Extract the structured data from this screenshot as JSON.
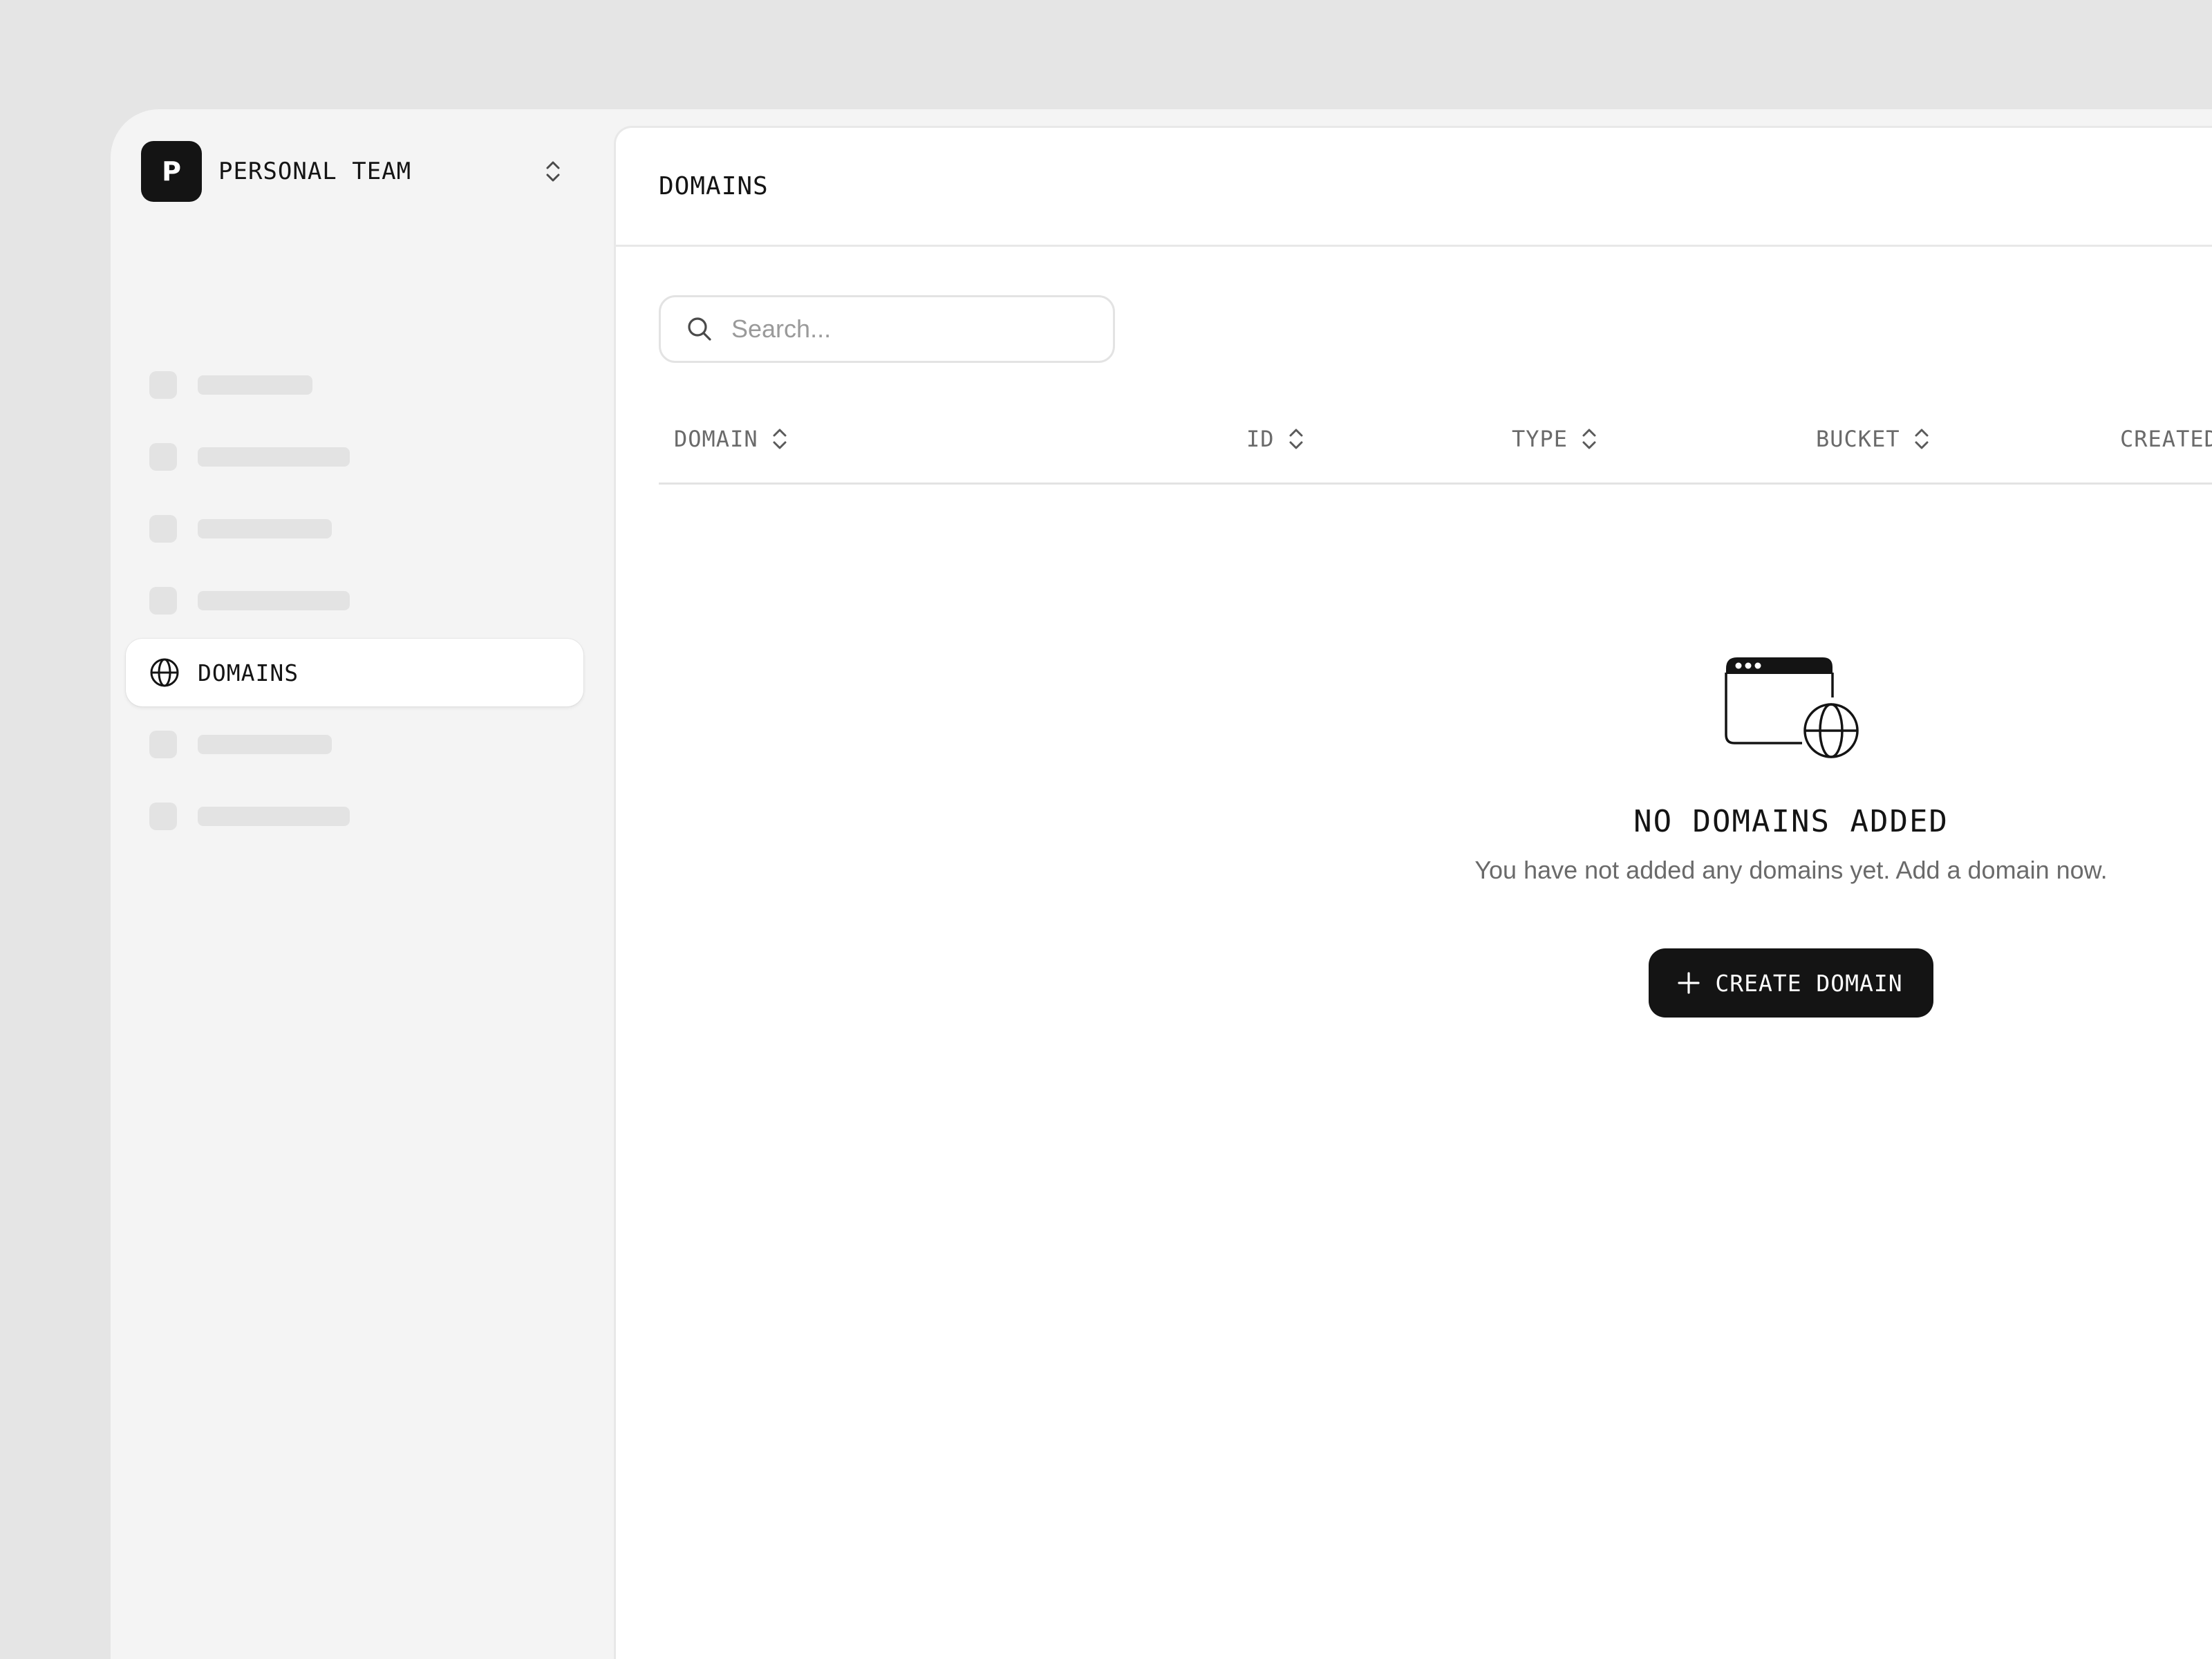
{
  "team": {
    "avatar_letter": "P",
    "name": "PERSONAL TEAM"
  },
  "nav": {
    "active_item": {
      "label": "DOMAINS",
      "icon": "globe-icon"
    }
  },
  "header": {
    "title": "DOMAINS"
  },
  "search": {
    "placeholder": "Search..."
  },
  "table": {
    "columns": [
      "DOMAIN",
      "ID",
      "TYPE",
      "BUCKET",
      "CREATED"
    ]
  },
  "empty_state": {
    "title": "NO DOMAINS ADDED",
    "description": "You have not added any domains yet. Add a domain now.",
    "button_label": "CREATE DOMAIN"
  },
  "colors": {
    "background": "#e5e5e5",
    "sidebar": "#f4f4f4",
    "panel": "#ffffff",
    "primary": "#141414",
    "muted_text": "#6a6a6a",
    "skeleton": "#e3e3e3"
  }
}
